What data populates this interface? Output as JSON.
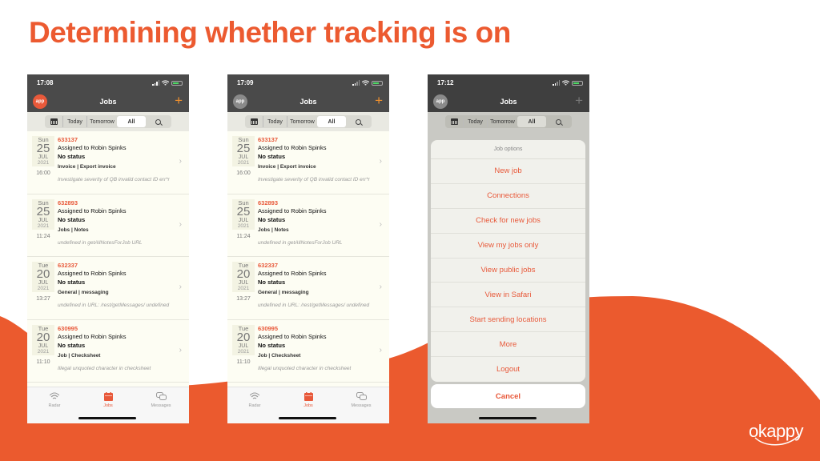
{
  "slide": {
    "title": "Determining whether tracking is on",
    "brand": "okappy",
    "accent_color": "#ec5a30"
  },
  "phones": [
    {
      "status_time": "17:08",
      "nav_title": "Jobs",
      "app_logo_text": "app",
      "app_logo_state": "tracking-on",
      "plus_label": "+",
      "filters": {
        "today": "Today",
        "tomorrow": "Tomorrow",
        "all": "All",
        "selected": "All"
      },
      "jobs": [
        {
          "dow": "Sun",
          "day": "25",
          "month": "JUL",
          "year": "2021",
          "time": "16:00",
          "id": "633137",
          "assigned": "Assigned to Robin Spinks",
          "status": "No status",
          "category": "Invoice | Export invoice",
          "note": "Investigate  severity of QB invalid contact ID err*r"
        },
        {
          "dow": "Sun",
          "day": "25",
          "month": "JUL",
          "year": "2021",
          "time": "11:24",
          "id": "632893",
          "assigned": "Assigned to Robin Spinks",
          "status": "No status",
          "category": "Jobs | Notes",
          "note": "undefined in getAllNotesForJob URL"
        },
        {
          "dow": "Tue",
          "day": "20",
          "month": "JUL",
          "year": "2021",
          "time": "13:27",
          "id": "632337",
          "assigned": "Assigned to Robin Spinks",
          "status": "No status",
          "category": "General | messaging",
          "note": "undefined in URL: /rest/getMessages/ undefined"
        },
        {
          "dow": "Tue",
          "day": "20",
          "month": "JUL",
          "year": "2021",
          "time": "11:10",
          "id": "630995",
          "assigned": "Assigned to Robin Spinks",
          "status": "No status",
          "category": "Job | Checksheet",
          "note": "Illegal unquoted character in checksheet"
        }
      ],
      "tabs": [
        {
          "label": "Radar"
        },
        {
          "label": "Jobs",
          "active": true
        },
        {
          "label": "Messages"
        }
      ]
    },
    {
      "status_time": "17:09",
      "nav_title": "Jobs",
      "app_logo_text": "app",
      "app_logo_state": "tracking-off",
      "plus_label": "+",
      "filters": {
        "today": "Today",
        "tomorrow": "Tomorrow",
        "all": "All",
        "selected": "All"
      },
      "jobs": [
        {
          "dow": "Sun",
          "day": "25",
          "month": "JUL",
          "year": "2021",
          "time": "16:00",
          "id": "633137",
          "assigned": "Assigned to Robin Spinks",
          "status": "No status",
          "category": "Invoice | Export invoice",
          "note": "Investigate  severity of QB invalid contact ID err*r"
        },
        {
          "dow": "Sun",
          "day": "25",
          "month": "JUL",
          "year": "2021",
          "time": "11:24",
          "id": "632893",
          "assigned": "Assigned to Robin Spinks",
          "status": "No status",
          "category": "Jobs | Notes",
          "note": "undefined in getAllNotesForJob URL"
        },
        {
          "dow": "Tue",
          "day": "20",
          "month": "JUL",
          "year": "2021",
          "time": "13:27",
          "id": "632337",
          "assigned": "Assigned to Robin Spinks",
          "status": "No status",
          "category": "General | messaging",
          "note": "undefined in URL: /rest/getMessages/ undefined"
        },
        {
          "dow": "Tue",
          "day": "20",
          "month": "JUL",
          "year": "2021",
          "time": "11:10",
          "id": "630995",
          "assigned": "Assigned to Robin Spinks",
          "status": "No status",
          "category": "Job | Checksheet",
          "note": "Illegal unquoted character in checksheet"
        }
      ],
      "tabs": [
        {
          "label": "Radar"
        },
        {
          "label": "Jobs",
          "active": true
        },
        {
          "label": "Messages"
        }
      ]
    },
    {
      "status_time": "17:12",
      "nav_title": "Jobs",
      "app_logo_text": "app",
      "app_logo_state": "tracking-off",
      "plus_label": "+",
      "filters": {
        "today": "Today",
        "tomorrow": "Tomorrow",
        "all": "All",
        "selected": "All"
      },
      "sheet": {
        "title": "Job options",
        "items": [
          "New job",
          "Connections",
          "Check for new jobs",
          "View my jobs only",
          "View public jobs",
          "View in Safari",
          "Start sending locations",
          "More",
          "Logout"
        ],
        "cancel": "Cancel"
      }
    }
  ]
}
